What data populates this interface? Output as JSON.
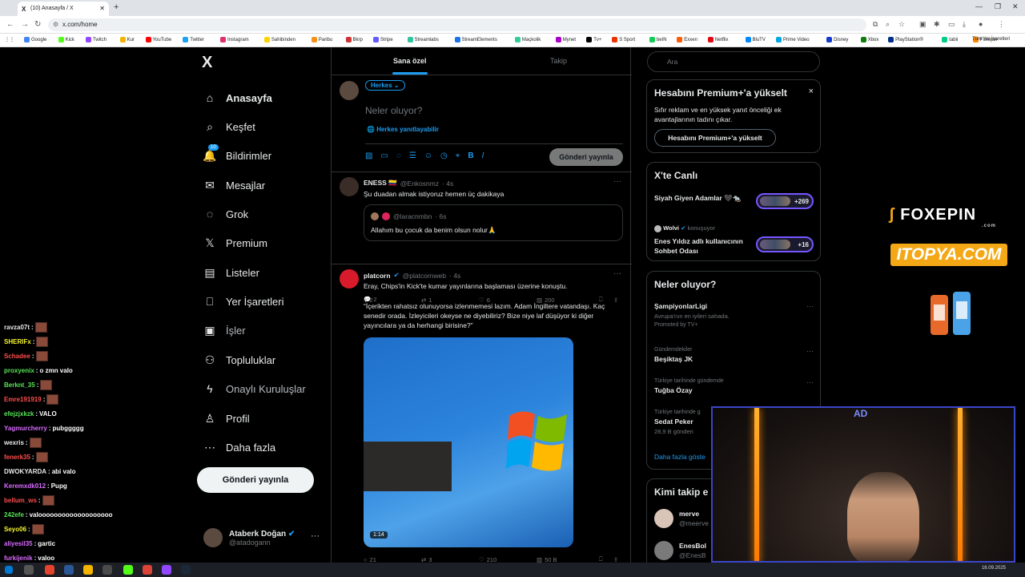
{
  "browser": {
    "tab_title": "(10) Anasayfa / X",
    "tab_icon": "X",
    "new_tab": "+",
    "url": "x.com/home",
    "bookmarks": [
      "Google",
      "Kick",
      "Twitch",
      "Kur",
      "YouTube",
      "Twitter",
      "Instagram",
      "Sahibinden",
      "Paribu",
      "Bkrp",
      "Stripe",
      "Streamlabs",
      "StreamElements",
      "Maçkolik",
      "Mynet",
      "Tv+",
      "S Sport",
      "beIN",
      "Exxen",
      "Netflix",
      "BluTV",
      "Prime Video",
      "Disney",
      "Xbox",
      "PlayStation®",
      "tabii",
      "Foxepin"
    ],
    "all_bookmarks": "Tüm Yer İşaretleri"
  },
  "sidebar": {
    "logo": "X",
    "items": [
      {
        "label": "Anasayfa",
        "icon": "⌂"
      },
      {
        "label": "Keşfet",
        "icon": "⌕"
      },
      {
        "label": "Bildirimler",
        "icon": "🔔",
        "badge": "10"
      },
      {
        "label": "Mesajlar",
        "icon": "✉"
      },
      {
        "label": "Grok",
        "icon": "◌"
      },
      {
        "label": "Premium",
        "icon": "𝕏"
      },
      {
        "label": "Listeler",
        "icon": "▤"
      },
      {
        "label": "Yer İşaretleri",
        "icon": "⎕"
      },
      {
        "label": "İşler",
        "icon": "▣"
      },
      {
        "label": "Topluluklar",
        "icon": "⚇"
      },
      {
        "label": "Onaylı Kuruluşlar",
        "icon": "ϟ"
      },
      {
        "label": "Profil",
        "icon": "♙"
      },
      {
        "label": "Daha fazla",
        "icon": "⋯"
      }
    ],
    "post_button": "Gönderi yayınla",
    "account": {
      "name": "Ataberk Doğan",
      "handle": "@atadogann",
      "more": "···"
    }
  },
  "feed": {
    "tabs": [
      "Sana özel",
      "Takip"
    ],
    "composer": {
      "audience": "Herkes ⌄",
      "placeholder": "Neler oluyor?",
      "reply_setting": "Herkes yanıtlayabilir",
      "post_button": "Gönderi yayınla"
    },
    "posts": [
      {
        "name": "ENESS 🇨🇴",
        "handle": "@Enkosnmz",
        "time": "· 4s",
        "text": "Şu duadan almak istiyoruz hemen üç dakikaya",
        "quote": {
          "handle": "@laracnmbn",
          "time": "· 6s",
          "text": "Allahım bu çocuk da benim olsun nolur🙏"
        },
        "stats": {
          "replies": "2",
          "reposts": "1",
          "likes": "6",
          "views": "200"
        }
      },
      {
        "name": "platcorn",
        "handle": "@platcornweb",
        "time": "· 4s",
        "text": "Eray, Chips'in Kick'te kumar yayınlarına başlaması üzerine konuştu.",
        "quote_text": "“İçerikten rahatsız olunuyorsa izlenmemesi lazım. Adam İngiltere vatandaşı. Kaç senedir orada. İzleyicileri okeyse ne diyebiliriz? Bize niye laf düşüyor ki diğer yayıncılara ya da herhangi birisine?”",
        "video_time": "1:14",
        "stats": {
          "replies": "21",
          "reposts": "3",
          "likes": "210",
          "views": "50 B"
        }
      }
    ]
  },
  "right": {
    "search_placeholder": "Ara",
    "premium": {
      "title": "Hesabını Premium+'a yükselt",
      "desc": "Sıfır reklam ve en yüksek yanıt önceliği ek avantajlarının tadını çıkar.",
      "button": "Hesabını Premium+'a yükselt",
      "close": "×"
    },
    "live": {
      "title": "X'te Canlı",
      "items": [
        {
          "title": "Siyah Giyen Adamlar 🖤🐀",
          "count": "+269"
        },
        {
          "host": "Wolvi",
          "status": "konuşuyor",
          "title": "Enes Yıldız adlı kullanıcının Sohbet Odası",
          "count": "+16"
        }
      ]
    },
    "trends": {
      "title": "Neler oluyor?",
      "items": [
        {
          "name": "ŞampiyonlarLigi",
          "sub": "Avrupa'nın en iyileri sahada.",
          "promo": "Promoted by TV+"
        },
        {
          "cat": "Gündemdekiler",
          "name": "Beşiktaş JK"
        },
        {
          "cat": "Türkiye tarihinde gündemde",
          "name": "Tuğba Özay"
        },
        {
          "cat": "Türkiye tarihinde g",
          "name": "Sedat Peker",
          "sub": "28,9 B gönderi"
        }
      ],
      "more": "Daha fazla göste"
    },
    "follow": {
      "title": "Kimi takip e",
      "items": [
        {
          "name": "merve",
          "handle": "@meerve"
        },
        {
          "name": "EnesBol",
          "handle": "@EnesB"
        }
      ]
    }
  },
  "chat": [
    {
      "user": "ravza07t",
      "msg": "",
      "color": "#e7e9ea",
      "emote": true
    },
    {
      "user": "SHERIFx",
      "msg": "",
      "color": "#f7f72e",
      "emote": true
    },
    {
      "user": "Schadee",
      "msg": "",
      "color": "#ff4d4d",
      "emote": true
    },
    {
      "user": "proxyenix",
      "msg": "o zmn valo",
      "color": "#57e657",
      "emote": false
    },
    {
      "user": "Berknt_35",
      "msg": "",
      "color": "#57e657",
      "emote": true
    },
    {
      "user": "Emre191919",
      "msg": "",
      "color": "#ff4d4d",
      "emote": true
    },
    {
      "user": "efejzjxkzk",
      "msg": "VALO",
      "color": "#57e657",
      "emote": false
    },
    {
      "user": "Yagmurcherry",
      "msg": "pubggggg",
      "color": "#d96bff",
      "emote": false
    },
    {
      "user": "wexris",
      "msg": "",
      "color": "#e7e9ea",
      "emote": true
    },
    {
      "user": "fenerk35",
      "msg": "",
      "color": "#ff4d4d",
      "emote": true
    },
    {
      "user": "DWOKYARDA",
      "msg": "abi valo",
      "color": "#e7e9ea",
      "emote": false
    },
    {
      "user": "Keremxdk012",
      "msg": "Pupg",
      "color": "#d96bff",
      "emote": false
    },
    {
      "user": "bellum_ws",
      "msg": "",
      "color": "#ff4d4d",
      "emote": true
    },
    {
      "user": "242efe",
      "msg": "valooooooooooooooooooo",
      "color": "#57e657",
      "emote": false
    },
    {
      "user": "Seyo06",
      "msg": "",
      "color": "#f7f72e",
      "emote": true
    },
    {
      "user": "aliyesil35",
      "msg": "gartic",
      "color": "#d96bff",
      "emote": false
    },
    {
      "user": "furkijenik",
      "msg": "valoo",
      "color": "#d96bff",
      "emote": false
    }
  ],
  "overlay": {
    "sponsor1": "FOXEPIN",
    "sponsor1_sub": ".com",
    "sponsor2": "ITOPYA.COM",
    "cam_logo": "AD"
  },
  "taskbar": {
    "time": "16.09.2025"
  },
  "colors": {
    "accent": "#1d9bf0",
    "bg": "#000000",
    "border": "#2f3336",
    "muted": "#71767b"
  }
}
